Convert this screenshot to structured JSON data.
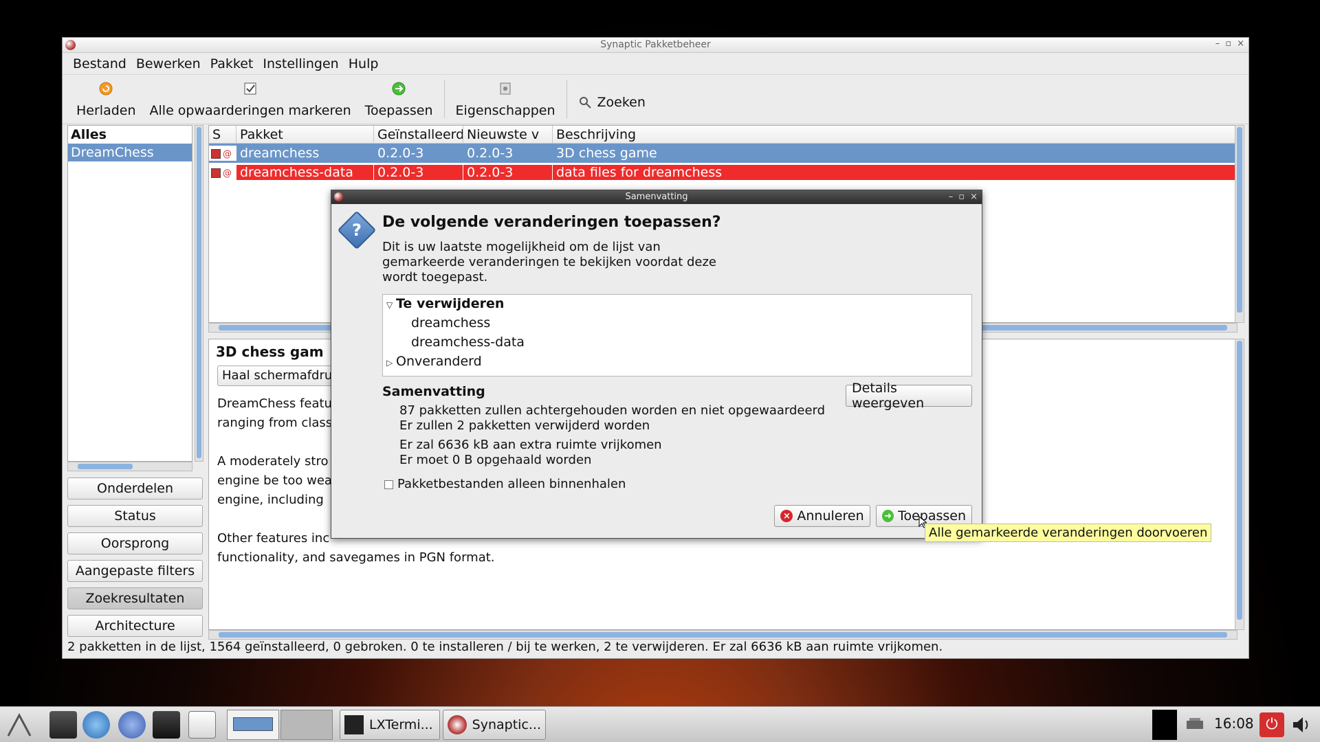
{
  "main_window": {
    "title": "Synaptic Pakketbeheer",
    "menu": [
      "Bestand",
      "Bewerken",
      "Pakket",
      "Instellingen",
      "Hulp"
    ],
    "toolbar": {
      "reload": "Herladen",
      "mark_upgrades": "Alle opwaarderingen markeren",
      "apply": "Toepassen",
      "properties": "Eigenschappen",
      "search": "Zoeken"
    },
    "filters": {
      "header": "Alles",
      "selected": "DreamChess"
    },
    "side_buttons": [
      "Onderdelen",
      "Status",
      "Oorsprong",
      "Aangepaste filters",
      "Zoekresultaten",
      "Architecture"
    ],
    "table": {
      "headers": [
        "S",
        "Pakket",
        "Geïnstalleerd",
        "Nieuwste v",
        "Beschrijving"
      ],
      "rows": [
        {
          "name": "dreamchess",
          "installed": "0.2.0-3",
          "latest": "0.2.0-3",
          "description": "3D chess game"
        },
        {
          "name": "dreamchess-data",
          "installed": "0.2.0-3",
          "latest": "0.2.0-3",
          "description": "data files for dreamchess"
        }
      ]
    },
    "description": {
      "title": "3D chess gam",
      "screenshot_button": "Haal schermafdru",
      "body": "DreamChess featu\nranging from class\n\nA moderately stro\nengine be too wea\nengine, including \n\nOther features inc\nfunctionality, and savegames in PGN format."
    },
    "status_bar": "2 pakketten in de lijst, 1564 geïnstalleerd, 0 gebroken. 0 te installeren / bij te werken, 2 te verwijderen. Er zal 6636 kB aan ruimte vrijkomen."
  },
  "dialog": {
    "title": "Samenvatting",
    "heading": "De volgende veranderingen toepassen?",
    "intro": "Dit is uw laatste mogelijkheid om de lijst van gemarkeerde veranderingen te bekijken voordat deze wordt toegepast.",
    "tree": {
      "remove_label": "Te verwijderen",
      "remove_items": [
        "dreamchess",
        "dreamchess-data"
      ],
      "unchanged_label": "Onveranderd"
    },
    "summary_heading": "Samenvatting",
    "summary_lines": [
      "87 pakketten zullen achtergehouden worden en niet opgewaardeerd",
      "Er zullen 2 pakketten verwijderd worden",
      "Er zal 6636 kB aan extra ruimte vrijkomen",
      "Er moet 0  B opgehaald worden"
    ],
    "details_button": "Details weergeven",
    "checkbox_label": "Pakketbestanden alleen binnenhalen",
    "cancel_button": "Annuleren",
    "apply_button": "Toepassen"
  },
  "tooltip": "Alle gemarkeerde veranderingen doorvoeren",
  "taskbar": {
    "tasks": [
      "LXTermi...",
      "Synaptic..."
    ],
    "clock": "16:08"
  },
  "colors": {
    "selection": "#6a95c9",
    "removal_red": "#ef2b2b",
    "tooltip_bg": "#fdfd9e"
  }
}
